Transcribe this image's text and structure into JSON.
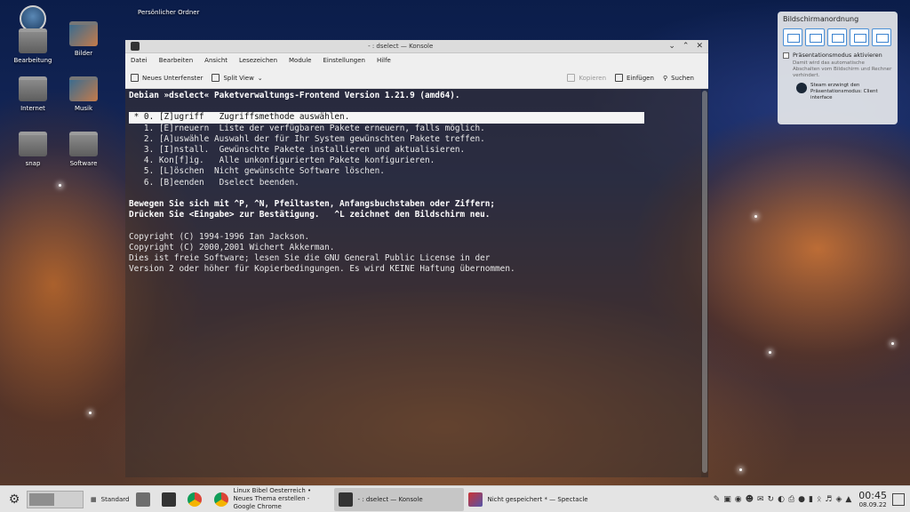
{
  "desktop": {
    "top_label": "Persönlicher Ordner",
    "icons": [
      {
        "label": "Bearbeitung"
      },
      {
        "label": "Bilder"
      },
      {
        "label": "Internet"
      },
      {
        "label": "Musik"
      },
      {
        "label": "snap"
      },
      {
        "label": "Software"
      }
    ]
  },
  "window": {
    "title": "- : dselect — Konsole",
    "menu": [
      "Datei",
      "Bearbeiten",
      "Ansicht",
      "Lesezeichen",
      "Module",
      "Einstellungen",
      "Hilfe"
    ],
    "toolbar": {
      "new_tab": "Neues Unterfenster",
      "split_view": "Split View",
      "copy": "Kopieren",
      "paste": "Einfügen",
      "search": "Suchen"
    },
    "terminal": {
      "header": "Debian »dselect« Paketverwaltungs-Frontend Version 1.21.9 (amd64).",
      "selected_item": " * 0. [Z]ugriff   Zugriffsmethode auswählen.",
      "items": [
        "   1. [E]rneuern  Liste der verfügbaren Pakete erneuern, falls möglich.",
        "   2. [A]uswähle Auswahl der für Ihr System gewünschten Pakete treffen.",
        "   3. [I]nstall.  Gewünschte Pakete installieren und aktualisieren.",
        "   4. Kon[f]ig.   Alle unkonfigurierten Pakete konfigurieren.",
        "   5. [L]öschen  Nicht gewünschte Software löschen.",
        "   6. [B]eenden   Dselect beenden."
      ],
      "help1": "Bewegen Sie sich mit ^P, ^N, Pfeiltasten, Anfangsbuchstaben oder Ziffern;",
      "help2": "Drücken Sie <Eingabe> zur Bestätigung.   ^L zeichnet den Bildschirm neu.",
      "copyright": [
        "Copyright (C) 1994-1996 Ian Jackson.",
        "Copyright (C) 2000,2001 Wichert Akkerman.",
        "Dies ist freie Software; lesen Sie die GNU General Public License in der",
        "Version 2 oder höher für Kopierbedingungen. Es wird KEINE Haftung übernommen."
      ]
    }
  },
  "popup": {
    "title": "Bildschirmanordnung",
    "presentation_label": "Präsentationsmodus aktivieren",
    "presentation_sub": "Damit wird das automatische Abschalten vom Bildschirm und Rechner verhindert.",
    "steam_text": "Steam erzwingt den Präsentationsmodus: Client interface"
  },
  "taskbar": {
    "standard_label": "Standard",
    "tasks": [
      {
        "label": "Linux Bibel Oesterreich • Neues Thema erstellen - Google Chrome",
        "active": false
      },
      {
        "label": "- : dselect — Konsole",
        "active": true
      },
      {
        "label": "Nicht gespeichert * — Spectacle",
        "active": false
      }
    ],
    "time": "00:45",
    "date": "08.09.22"
  }
}
